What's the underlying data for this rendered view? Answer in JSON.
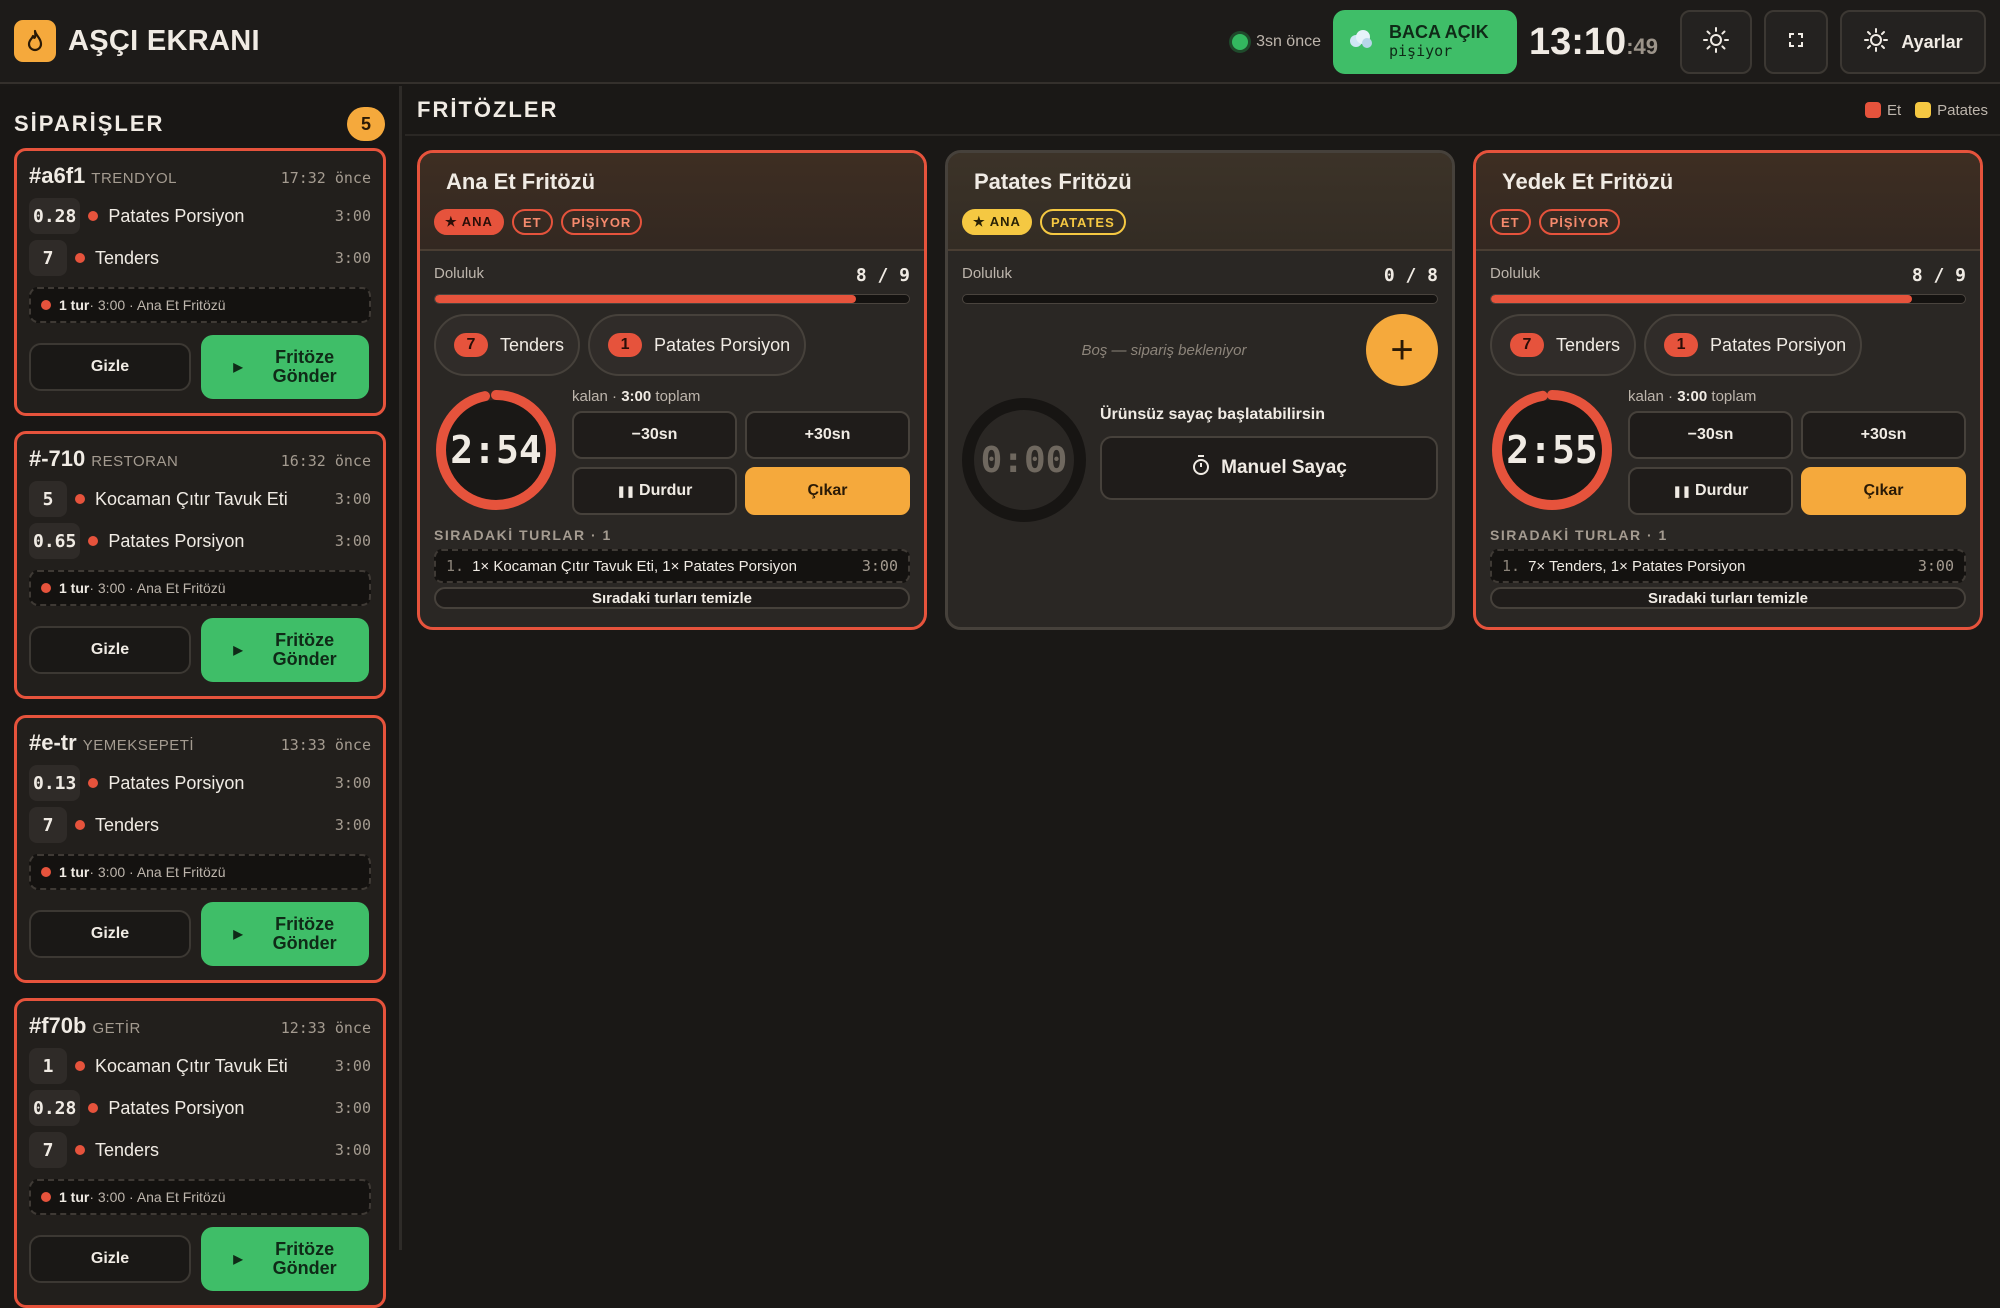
{
  "header": {
    "app_title": "AŞÇI EKRANI",
    "live_label": "3sn önce",
    "baca_title": "BACA AÇIK",
    "baca_sub": "pişiyor",
    "clock_main": "13:10",
    "clock_sec": ":49",
    "settings_label": "Ayarlar"
  },
  "sidebar": {
    "title": "SİPARİŞLER",
    "count": "5",
    "hide_label": "Gizle",
    "send_label_1": "Fritöze",
    "send_label_2": "Gönder",
    "orders": [
      {
        "id": "#a6f1",
        "source": "TRENDYOL",
        "time": "17:32 önce",
        "items": [
          {
            "qty": "0.28",
            "name": "Patates Porsiyon",
            "dur": "3:00"
          },
          {
            "qty": "7",
            "name": "Tenders",
            "dur": "3:00"
          }
        ],
        "tur_count": "1 tur",
        "tur_info": " · 3:00 · Ana Et Fritözü"
      },
      {
        "id": "#-710",
        "source": "RESTORAN",
        "time": "16:32 önce",
        "items": [
          {
            "qty": "5",
            "name": "Kocaman Çıtır Tavuk Eti",
            "dur": "3:00"
          },
          {
            "qty": "0.65",
            "name": "Patates Porsiyon",
            "dur": "3:00"
          }
        ],
        "tur_count": "1 tur",
        "tur_info": " · 3:00 · Ana Et Fritözü"
      },
      {
        "id": "#e-tr",
        "source": "YEMEKSEPETİ",
        "time": "13:33 önce",
        "items": [
          {
            "qty": "0.13",
            "name": "Patates Porsiyon",
            "dur": "3:00"
          },
          {
            "qty": "7",
            "name": "Tenders",
            "dur": "3:00"
          }
        ],
        "tur_count": "1 tur",
        "tur_info": " · 3:00 · Ana Et Fritözü"
      },
      {
        "id": "#f70b",
        "source": "GETİR",
        "time": "12:33 önce",
        "items": [
          {
            "qty": "1",
            "name": "Kocaman Çıtır Tavuk Eti",
            "dur": "3:00"
          },
          {
            "qty": "0.28",
            "name": "Patates Porsiyon",
            "dur": "3:00"
          },
          {
            "qty": "7",
            "name": "Tenders",
            "dur": "3:00"
          }
        ],
        "tur_count": "1 tur",
        "tur_info": " · 3:00 · Ana Et Fritözü"
      }
    ]
  },
  "main": {
    "title": "FRİTÖZLER",
    "legend": [
      {
        "label": "Et",
        "color": "#e6533c"
      },
      {
        "label": "Patates",
        "color": "#f5c842"
      }
    ],
    "fill_label": "Doluluk",
    "fryers": [
      {
        "name": "Ana Et Fritözü",
        "tags": [
          "★ ANA",
          "ET",
          "PİŞİYOR"
        ],
        "fill": "8 / 9",
        "fill_frac": 0.889,
        "chips": [
          {
            "qty": "7",
            "name": "Tenders"
          },
          {
            "qty": "1",
            "name": "Patates Porsiyon"
          }
        ],
        "timer": "2:54",
        "progress": 0.967,
        "kalan_pre": "kalan · ",
        "kalan_total": "3:00",
        "kalan_post": " toplam",
        "minus": "−30sn",
        "plus": "+30sn",
        "pause": "Durdur",
        "out": "Çıkar",
        "queue_title": "SIRADAKİ TURLAR · 1",
        "queue": [
          {
            "n": "1.",
            "text": "1× Kocaman Çıtır Tavuk Eti, 1× Patates Porsiyon",
            "dur": "3:00"
          }
        ],
        "clear": "Sıradaki turları temizle"
      },
      {
        "name": "Patates Fritözü",
        "tags": [
          "★ ANA",
          "PATATES"
        ],
        "fill": "0 / 8",
        "fill_frac": 0,
        "empty_text": "Boş — sipariş bekleniyor",
        "timer": "0:00",
        "manual_hint": "Ürünsüz sayaç başlatabilirsin",
        "manual_btn": "Manuel Sayaç"
      },
      {
        "name": "Yedek Et Fritözü",
        "tags": [
          "ET",
          "PİŞİYOR"
        ],
        "fill": "8 / 9",
        "fill_frac": 0.889,
        "chips": [
          {
            "qty": "7",
            "name": "Tenders"
          },
          {
            "qty": "1",
            "name": "Patates Porsiyon"
          }
        ],
        "timer": "2:55",
        "progress": 0.972,
        "kalan_pre": "kalan · ",
        "kalan_total": "3:00",
        "kalan_post": " toplam",
        "minus": "−30sn",
        "plus": "+30sn",
        "pause": "Durdur",
        "out": "Çıkar",
        "queue_title": "SIRADAKİ TURLAR · 1",
        "queue": [
          {
            "n": "1.",
            "text": "7× Tenders, 1× Patates Porsiyon",
            "dur": "3:00"
          }
        ],
        "clear": "Sıradaki turları temizle"
      }
    ]
  }
}
